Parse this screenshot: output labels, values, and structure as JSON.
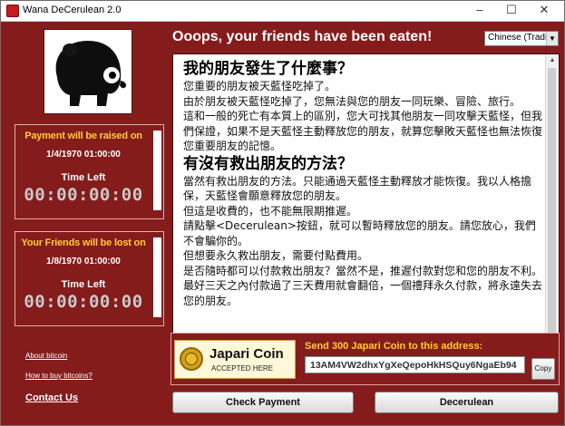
{
  "window": {
    "title": "Wana DeCerulean 2.0",
    "controls": {
      "minimize": "–",
      "maximize": "☐",
      "close": "✕"
    }
  },
  "header": {
    "title": "Ooops, your friends have been eaten!"
  },
  "language_select": {
    "value": "Chinese (Tradi"
  },
  "timers": [
    {
      "header": "Payment will be raised on",
      "date": "1/4/1970 01:00:00",
      "time_left_label": "Time Left",
      "countdown": "00:00:00:00"
    },
    {
      "header": "Your Friends will be lost on",
      "date": "1/8/1970 01:00:00",
      "time_left_label": "Time Left",
      "countdown": "00:00:00:00"
    }
  ],
  "links": {
    "about": "About bitcoin",
    "how_to_buy": "How to buy bitcoins?",
    "contact": "Contact Us"
  },
  "message": {
    "heading1": "我的朋友發生了什麼事？",
    "paragraphs1": [
      "您重要的朋友被天藍怪吃掉了。",
      "由於朋友被天藍怪吃掉了，您無法與您的朋友一同玩樂、冒險、旅行。",
      "這和一般的死亡有本質上的區別，您大可找其他朋友一同攻擊天藍怪，但我們保證，如果不是天藍怪主動釋放您的朋友，就算您擊敗天藍怪也無法恢復您重要朋友的記憶。"
    ],
    "heading2": "有沒有救出朋友的方法？",
    "paragraphs2": [
      "當然有救出朋友的方法。只能通過天藍怪主動釋放才能恢復。我以人格擔保，天藍怪會願意釋放您的朋友。",
      "但這是收費的，也不能無限期推遲。",
      "請點擊<Decerulean>按鈕，就可以暫時釋放您的朋友。請您放心，我們不會騙你的。",
      "但想要永久救出朋友，需要付點費用。",
      "是否隨時都可以付款救出朋友？當然不是，推遲付款對您和您的朋友不利。最好三天之內付款過了三天費用就會翻倍，一個禮拜永久付款，將永遠失去您的朋友。"
    ]
  },
  "payment": {
    "coin_name": "Japari Coin",
    "coin_sub": "ACCEPTED HERE",
    "send_label": "Send 300 Japari Coin to this address:",
    "address": "13AM4VW2dhxYgXeQepoHkHSQuy6NgaEb94",
    "copy_label": "Copy"
  },
  "buttons": {
    "check_payment": "Check Payment",
    "decerulean": "Decerulean"
  },
  "colors": {
    "background": "#851c1c",
    "accent_yellow": "#ffcc33",
    "text_white": "#ffffff",
    "timer_digits": "#c9c9c9"
  }
}
